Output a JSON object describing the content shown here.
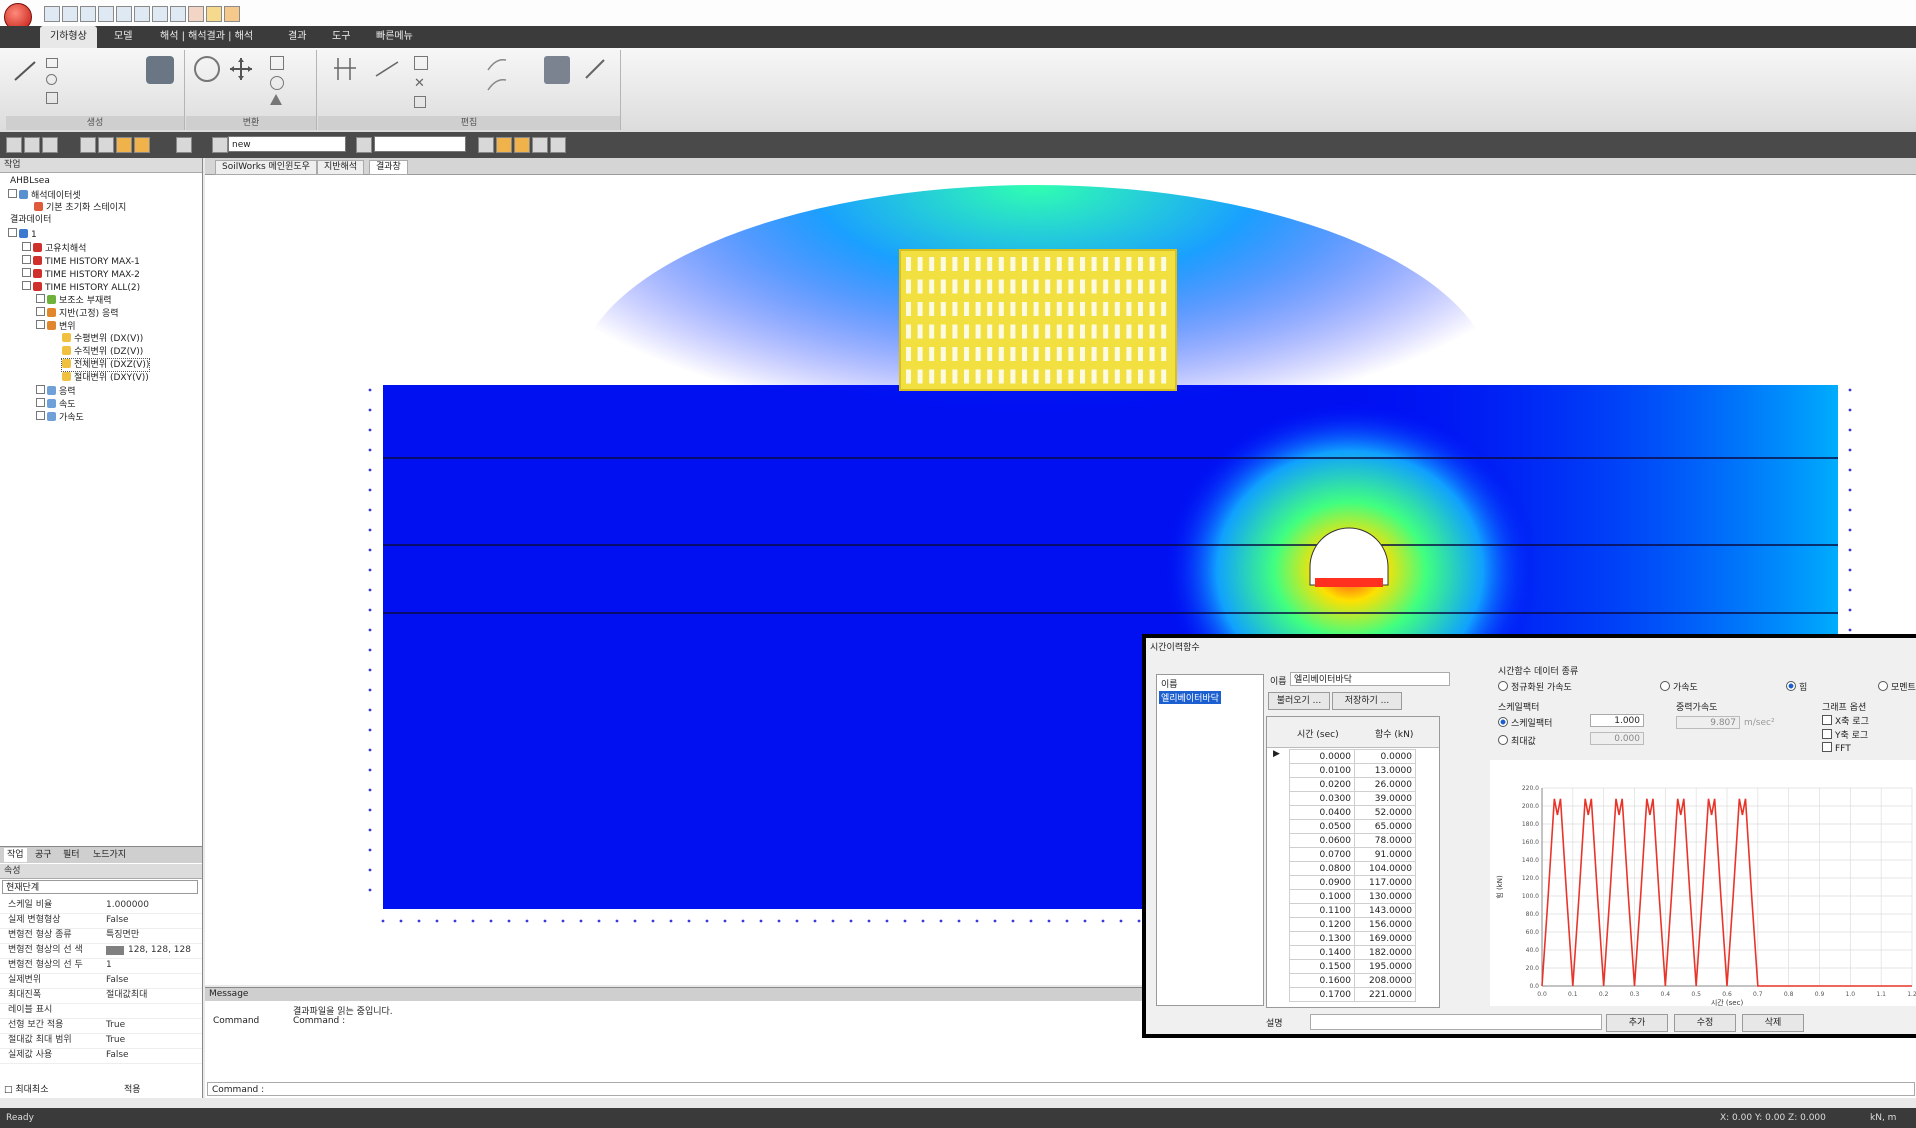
{
  "ribbon_tabs": [
    "기하형상",
    "모델",
    "해석 | 해석결과 | 해석",
    "결과",
    "도구",
    "빠른메뉴"
  ],
  "ribbon_groups": [
    "생성",
    "변환",
    "편집"
  ],
  "toolstrip": {
    "field1": "new",
    "field2": ""
  },
  "tree": {
    "root": "AHBLsea",
    "items": [
      "해석데이터셋",
      "기본 초기화 스테이지",
      "결과데이터",
      "1",
      "고유치해석",
      "TIME HISTORY MAX-1",
      "TIME HISTORY MAX-2",
      "TIME HISTORY ALL(2)",
      "보조소 부재력",
      "지반(고정) 응력",
      "변위",
      "수평변위 (DX(V))",
      "수직변위 (DZ(V))",
      "전체변위 (DXZ(V))",
      "절대변위 (DXY(V))",
      "응력",
      "속도",
      "가속도"
    ]
  },
  "panel_tabs": [
    "작업",
    "공구",
    "필터",
    "노드가지"
  ],
  "props": {
    "title": "속성",
    "header": "현재단계",
    "rows": [
      {
        "name": "스케일 비율",
        "value": "1.000000"
      },
      {
        "name": "실제 변형형상",
        "value": "False"
      },
      {
        "name": "변형전 형상 종류",
        "value": "특징면만"
      },
      {
        "name": "변형전 형상의 선 색",
        "value": "128, 128, 128"
      },
      {
        "name": "변형전 형상의 선 두",
        "value": "1"
      },
      {
        "name": "실제변위",
        "value": "False"
      },
      {
        "name": "최대진폭",
        "value": "절대값최대"
      },
      {
        "name": "레이블 표시",
        "value": ""
      },
      {
        "name": "선형 보간 적용",
        "value": "True"
      },
      {
        "name": "절대값 최대 범위",
        "value": "True"
      },
      {
        "name": "실제값 사용",
        "value": "False"
      }
    ],
    "footer_left": "□ 최대최소",
    "footer_right": "적용"
  },
  "doc_tabs": [
    "SoilWorks 메인윈도우",
    "지반해석",
    "결과창"
  ],
  "message": {
    "title": "Message",
    "line1": "결과파일을 읽는 중입니다.",
    "cmd1": "Command",
    "cmd2": "Command :",
    "bottom": "Command :"
  },
  "status": {
    "left": "Ready",
    "right": "X: 0.00  Y: 0.00  Z: 0.000",
    "unit": "kN, m"
  },
  "dialog": {
    "title": "시간이력함수",
    "list_header": "이름",
    "list_item": "엘리베이터바닥",
    "name_label": "이름",
    "name_value": "엘리베이터바닥",
    "btn_import": "불러오기 ...",
    "btn_export": "저장하기 ...",
    "col_time": "시간 (sec)",
    "col_value": "함수 (kN)",
    "table": [
      [
        "0.0000",
        "0.0000"
      ],
      [
        "0.0100",
        "13.0000"
      ],
      [
        "0.0200",
        "26.0000"
      ],
      [
        "0.0300",
        "39.0000"
      ],
      [
        "0.0400",
        "52.0000"
      ],
      [
        "0.0500",
        "65.0000"
      ],
      [
        "0.0600",
        "78.0000"
      ],
      [
        "0.0700",
        "91.0000"
      ],
      [
        "0.0800",
        "104.0000"
      ],
      [
        "0.0900",
        "117.0000"
      ],
      [
        "0.1000",
        "130.0000"
      ],
      [
        "0.1100",
        "143.0000"
      ],
      [
        "0.1200",
        "156.0000"
      ],
      [
        "0.1300",
        "169.0000"
      ],
      [
        "0.1400",
        "182.0000"
      ],
      [
        "0.1500",
        "195.0000"
      ],
      [
        "0.1600",
        "208.0000"
      ],
      [
        "0.1700",
        "221.0000"
      ]
    ],
    "type_title": "시간함수 데이터 종류",
    "type_opts": [
      "정규화된 가속도",
      "가속도",
      "힘",
      "모멘트"
    ],
    "scale_title": "스케일팩터",
    "scale_opts": [
      "스케일팩터",
      "최대값"
    ],
    "scale_val1": "1.000",
    "scale_val2": "0.000",
    "gravity_title": "중력가속도",
    "gravity_value": "9.807",
    "gravity_unit": "m/sec²",
    "graph_title": "그래프 옵션",
    "graph_opts": [
      "X축 로그",
      "Y축 로그",
      "FFT"
    ],
    "y_axis_label": "힘 (kN)",
    "x_axis_label": "시간 (sec)",
    "desc_label": "설명",
    "btn_add": "추가",
    "btn_modify": "수정",
    "btn_delete": "삭제"
  },
  "chart_data": {
    "type": "line",
    "title": "",
    "xlabel": "시간 (sec)",
    "ylabel": "힘 (kN)",
    "xlim": [
      0,
      1.2
    ],
    "ylim": [
      0,
      220
    ],
    "series": [
      {
        "x": [
          0,
          0.02,
          0.04,
          0.05,
          0.06,
          0.08,
          0.1,
          0.12,
          0.14,
          0.15,
          0.16,
          0.18,
          0.2,
          0.22,
          0.24,
          0.25,
          0.26,
          0.28,
          0.3,
          0.32,
          0.34,
          0.35,
          0.36,
          0.38,
          0.4,
          0.42,
          0.44,
          0.45,
          0.46,
          0.48,
          0.5,
          0.52,
          0.54,
          0.55,
          0.56,
          0.58,
          0.6,
          0.62,
          0.64,
          0.65,
          0.66,
          0.68,
          0.7,
          0.72,
          1.2
        ],
        "y": [
          0,
          100,
          208,
          190,
          208,
          100,
          0,
          100,
          208,
          190,
          208,
          100,
          0,
          100,
          208,
          190,
          208,
          100,
          0,
          100,
          208,
          190,
          208,
          100,
          0,
          100,
          208,
          190,
          208,
          100,
          0,
          100,
          208,
          190,
          208,
          100,
          0,
          100,
          208,
          190,
          208,
          100,
          0,
          0,
          0
        ]
      }
    ],
    "color": "#e8352a"
  }
}
